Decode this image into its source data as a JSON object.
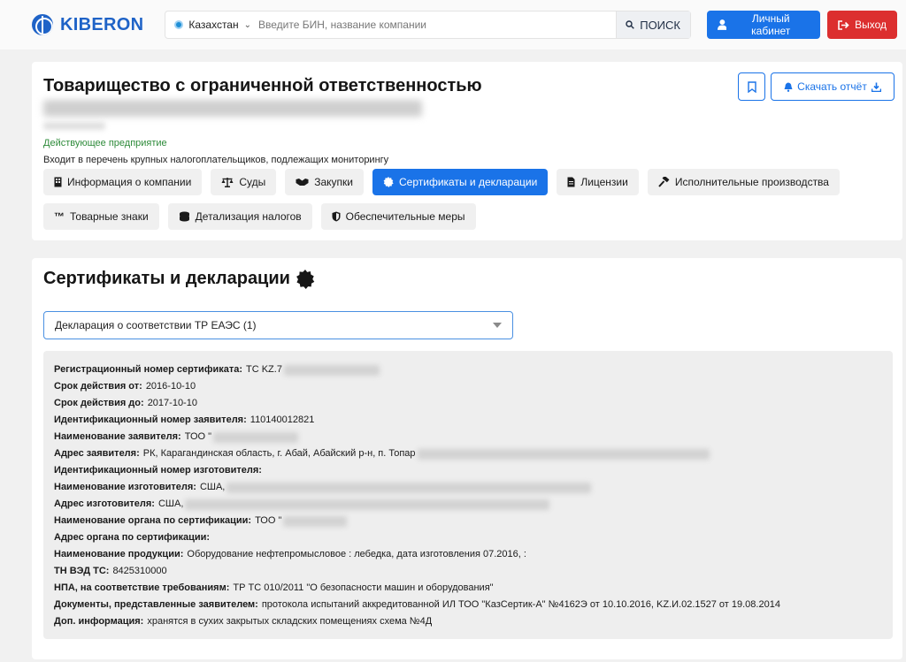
{
  "header": {
    "logo_text": "KIBERON",
    "region": "Казахстан",
    "search_placeholder": "Введите БИН, название компании",
    "search_button": "ПОИСК",
    "cabinet_button": "Личный кабинет",
    "exit_button": "Выход"
  },
  "company": {
    "title": "Товарищество с ограниченной ответственностью",
    "status": "Действующее предприятие",
    "note": "Входит в перечень крупных налогоплательщиков, подлежащих мониторингу",
    "report_button": "Скачать отчёт",
    "tabs": [
      {
        "label": "Информация о компании",
        "icon": "building-icon"
      },
      {
        "label": "Суды",
        "icon": "scales-icon"
      },
      {
        "label": "Закупки",
        "icon": "handshake-icon"
      },
      {
        "label": "Сертификаты и декларации",
        "icon": "certificate-icon"
      },
      {
        "label": "Лицензии",
        "icon": "document-icon"
      },
      {
        "label": "Исполнительные производства",
        "icon": "gavel-icon"
      },
      {
        "label": "Товарные знаки",
        "icon": "trademark-icon"
      },
      {
        "label": "Детализация налогов",
        "icon": "coins-icon"
      },
      {
        "label": "Обеспечительные меры",
        "icon": "shield-icon"
      }
    ],
    "active_tab": "Сертификаты и декларации"
  },
  "certificates": {
    "title": "Сертификаты и декларации",
    "selected": "Декларация о соответствии ТР ЕАЭС (1)",
    "rows": [
      {
        "label": "Регистрационный номер сертификата:",
        "value": "ТС KZ.7"
      },
      {
        "label": "Срок действия от:",
        "value": "2016-10-10"
      },
      {
        "label": "Срок действия до:",
        "value": "2017-10-10"
      },
      {
        "label": "Идентификационный номер заявителя:",
        "value": "110140012821"
      },
      {
        "label": "Наименование заявителя:",
        "value": "ТОО \""
      },
      {
        "label": "Адрес заявителя:",
        "value": "РК, Карагандинская область, г. Абай, Абайский р-н, п. Топар"
      },
      {
        "label": "Идентификационный номер изготовителя:",
        "value": ""
      },
      {
        "label": "Наименование изготовителя:",
        "value": "США,"
      },
      {
        "label": "Адрес изготовителя:",
        "value": "США,"
      },
      {
        "label": "Наименование органа по сертификации:",
        "value": "ТОО \""
      },
      {
        "label": "Адрес органа по сертификации:",
        "value": ""
      },
      {
        "label": "Наименование продукции:",
        "value": "Оборудование нефтепромысловое : лебедка, дата изготовления 07.2016, :"
      },
      {
        "label": "ТН ВЭД ТС:",
        "value": "8425310000"
      },
      {
        "label": "НПА, на соответствие требованиям:",
        "value": "ТР ТС 010/2011 \"О безопасности машин и оборудования\""
      },
      {
        "label": "Документы, представленные заявителем:",
        "value": "протокола испытаний аккредитованной ИЛ ТОО \"КазСертик-А\" №4162Э от 10.10.2016, KZ.И.02.1527 от 19.08.2014"
      },
      {
        "label": "Доп. информация:",
        "value": "хранятся в сухих закрытых складских помещениях схема №4Д"
      }
    ]
  },
  "colors": {
    "primary": "#1a73e8",
    "danger": "#dc2f2f",
    "status_green": "#2e8b3a"
  }
}
